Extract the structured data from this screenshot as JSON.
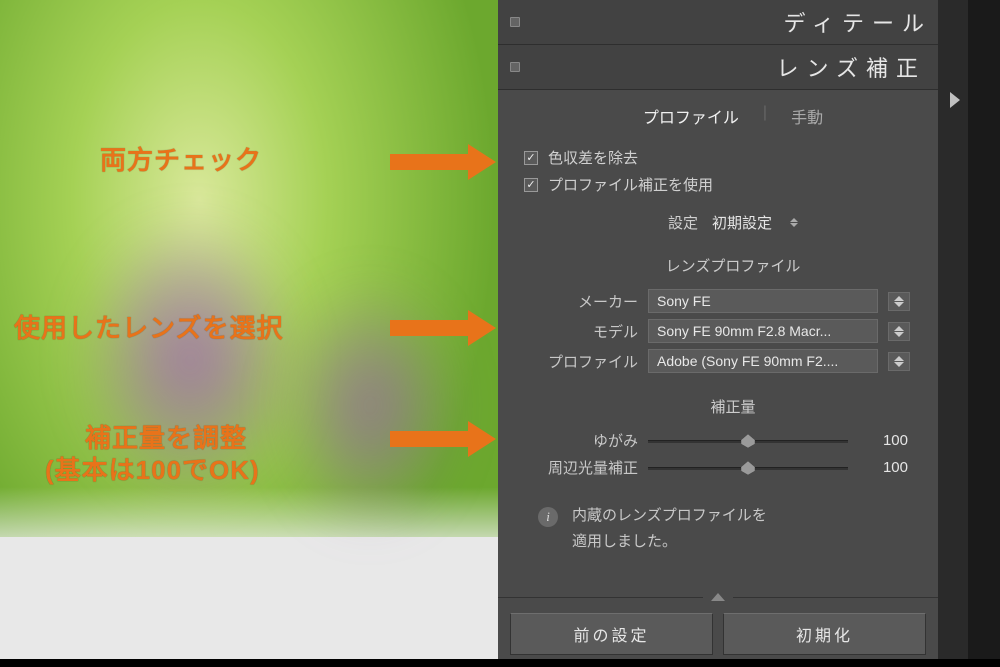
{
  "sections": {
    "detail": "ディテール",
    "lens_correction": "レンズ補正"
  },
  "tabs": {
    "profile": "プロファイル",
    "manual": "手動"
  },
  "checks": {
    "remove_ca": "色収差を除去",
    "use_profile": "プロファイル補正を使用"
  },
  "settings": {
    "label": "設定",
    "value": "初期設定"
  },
  "lens_profile": {
    "heading": "レンズプロファイル",
    "maker_label": "メーカー",
    "maker_value": "Sony FE",
    "model_label": "モデル",
    "model_value": "Sony FE 90mm F2.8 Macr...",
    "profile_label": "プロファイル",
    "profile_value": "Adobe (Sony FE 90mm F2...."
  },
  "correction": {
    "heading": "補正量",
    "distortion_label": "ゆがみ",
    "distortion_value": "100",
    "vignette_label": "周辺光量補正",
    "vignette_value": "100"
  },
  "info": {
    "line1": "内蔵のレンズプロファイルを",
    "line2": "適用しました。"
  },
  "buttons": {
    "prev": "前の設定",
    "reset": "初期化"
  },
  "annotations": {
    "check_both": "両方チェック",
    "select_lens": "使用したレンズを選択",
    "adjust_amount_l1": "補正量を調整",
    "adjust_amount_l2": "(基本は100でOK)"
  },
  "chart_data": null
}
